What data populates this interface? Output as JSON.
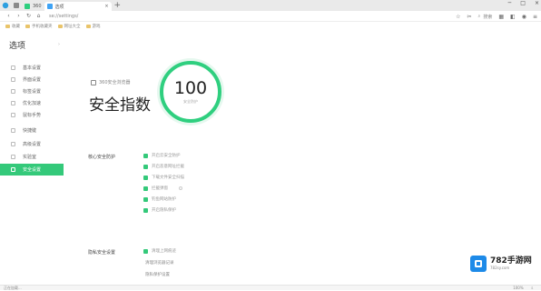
{
  "browser": {
    "tabs": [
      {
        "label": "360",
        "active": false
      },
      {
        "label": "选项",
        "active": true
      }
    ],
    "url": "se://settings/",
    "search_text": "搜索",
    "bookmarks": [
      "收藏",
      "手机收藏夹",
      "网址大全",
      "游戏"
    ]
  },
  "sidebar": {
    "title": "选项",
    "items": [
      {
        "label": "基本设置"
      },
      {
        "label": "界面设置"
      },
      {
        "label": "标签设置"
      },
      {
        "label": "优化加速"
      },
      {
        "label": "鼠标手势"
      },
      {
        "label": "快捷键"
      },
      {
        "label": "高级设置"
      },
      {
        "label": "实验室"
      },
      {
        "label": "安全设置"
      }
    ],
    "active_index": 8
  },
  "main": {
    "version_label": "360安全浏览器",
    "title": "安全指数",
    "score": "100",
    "score_sub": "安全防护",
    "section1_label": "核心安全防护",
    "section1_items": [
      "开启云安全防护",
      "开启恶意网址拦截",
      "下载文件安全扫描",
      "拦截弹窗",
      "钓鱼网站防护",
      "开启隐私保护"
    ],
    "section2_label": "隐私安全设置",
    "section2_items": [
      "清理上网痕迹",
      "清理浏览器记录",
      "隐私保护设置"
    ]
  },
  "status": {
    "left": "正在加载...",
    "right": "100%"
  },
  "watermark": {
    "main": "782手游网",
    "sub": "782sy.com"
  },
  "colors": {
    "accent": "#34c97a",
    "ring": "#2fcf7f"
  }
}
